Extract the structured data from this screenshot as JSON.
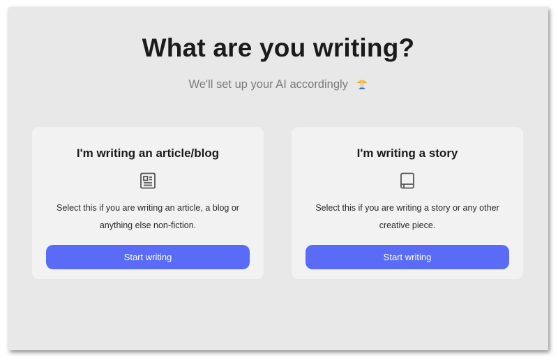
{
  "header": {
    "title": "What are you writing?",
    "subtitle": "We'll set up your AI accordingly",
    "subtitle_emoji": "worker-emoji"
  },
  "accent_color": "#5a6cf7",
  "cards": [
    {
      "title": "I'm writing an article/blog",
      "icon": "article-icon",
      "description": "Select this if you are writing an article, a blog or anything else non-fiction.",
      "button_label": "Start writing"
    },
    {
      "title": "I'm writing a story",
      "icon": "book-icon",
      "description": "Select this if you are writing a story or any other creative piece.",
      "button_label": "Start writing"
    }
  ]
}
